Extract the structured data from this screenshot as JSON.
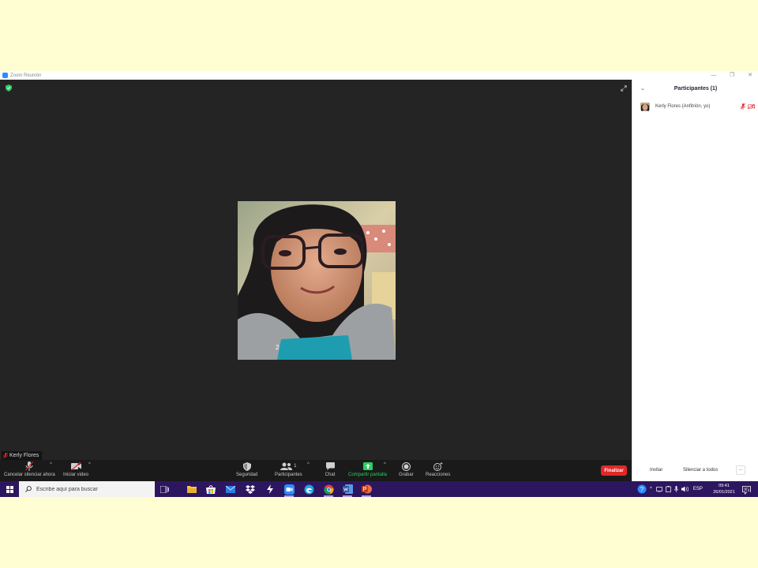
{
  "window": {
    "title": "Zoom Reunión",
    "controls": [
      "—",
      "❐",
      "✕"
    ]
  },
  "video": {
    "participant_name": "Kerly Flores"
  },
  "toolbar": {
    "unmute_label": "Cancelar silenciar ahora",
    "video_label": "Iniciar video",
    "security_label": "Seguridad",
    "participants_label": "Participantes",
    "participants_count": "1",
    "chat_label": "Chat",
    "share_label": "Compartir pantalla",
    "record_label": "Grabar",
    "reactions_label": "Reacciones",
    "end_label": "Finalizar",
    "caret": "^"
  },
  "panel": {
    "title": "Participantes (1)",
    "participants": [
      {
        "name": "Kerly Flores (Anfitrión, yo)"
      }
    ],
    "invite_label": "Invitar",
    "mute_all_label": "Silenciar a todos",
    "more_label": "..."
  },
  "taskbar": {
    "search_placeholder": "Escribe aquí para buscar",
    "language": "ESP",
    "time": "09:41",
    "date": "26/01/2021",
    "notification_count": "3"
  },
  "colors": {
    "page_bg": "#fffed2",
    "video_bg": "#242424",
    "toolbar_bg": "#1a1a1a",
    "share_green": "#2fcc63",
    "end_red": "#e02828",
    "taskbar_purple": "#2d1660",
    "zoom_blue": "#2d8cff"
  }
}
